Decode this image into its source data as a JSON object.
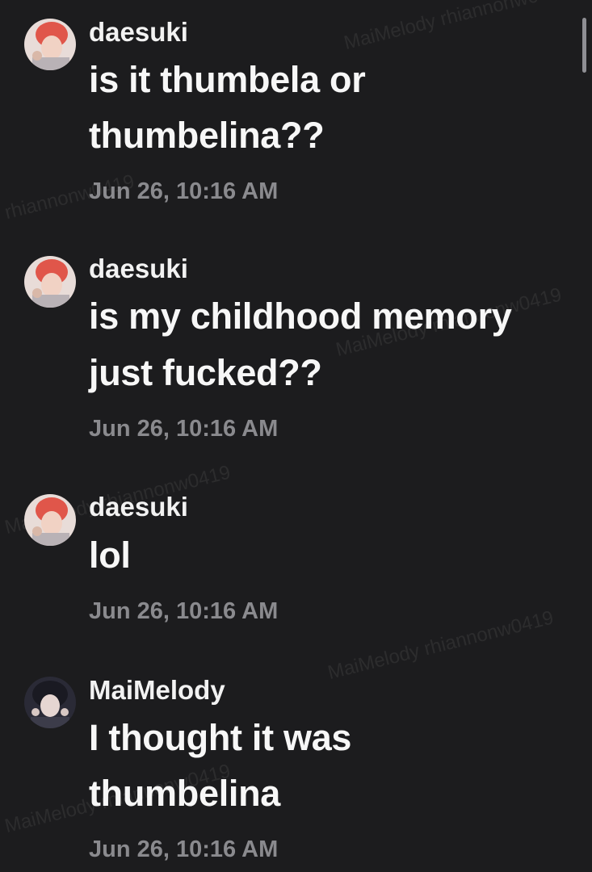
{
  "messages": [
    {
      "username": "daesuki",
      "lines": [
        "is it thumbela or",
        "thumbelina??"
      ],
      "timestamp": "Jun 26, 10:16 AM",
      "avatar": "daesuki-avatar"
    },
    {
      "username": "daesuki",
      "lines": [
        "is my childhood memory",
        "just fucked??"
      ],
      "timestamp": "Jun 26, 10:16 AM",
      "avatar": "daesuki-avatar"
    },
    {
      "username": "daesuki",
      "lines": [
        "lol"
      ],
      "timestamp": "Jun 26, 10:16 AM",
      "avatar": "daesuki-avatar"
    },
    {
      "username": "MaiMelody",
      "lines": [
        "I thought it was",
        "thumbelina"
      ],
      "timestamp": "Jun 26, 10:16 AM",
      "avatar": "maimelody-avatar"
    }
  ],
  "watermark": {
    "text": "MaiMelody rhiannonw0419",
    "fragments": [
      "MaiMelody rhiannonw0419",
      "rhiannonw0419",
      "MaiMelody rhiannonw0419",
      "MaiMelody rhiannonw0419",
      "MaiMelody rhiannonw0419",
      "MaiMelody rhiannonw0419"
    ]
  },
  "colors": {
    "background": "#1c1c1e",
    "text": "#f7f7f7",
    "timestamp": "#8a8a8e"
  }
}
